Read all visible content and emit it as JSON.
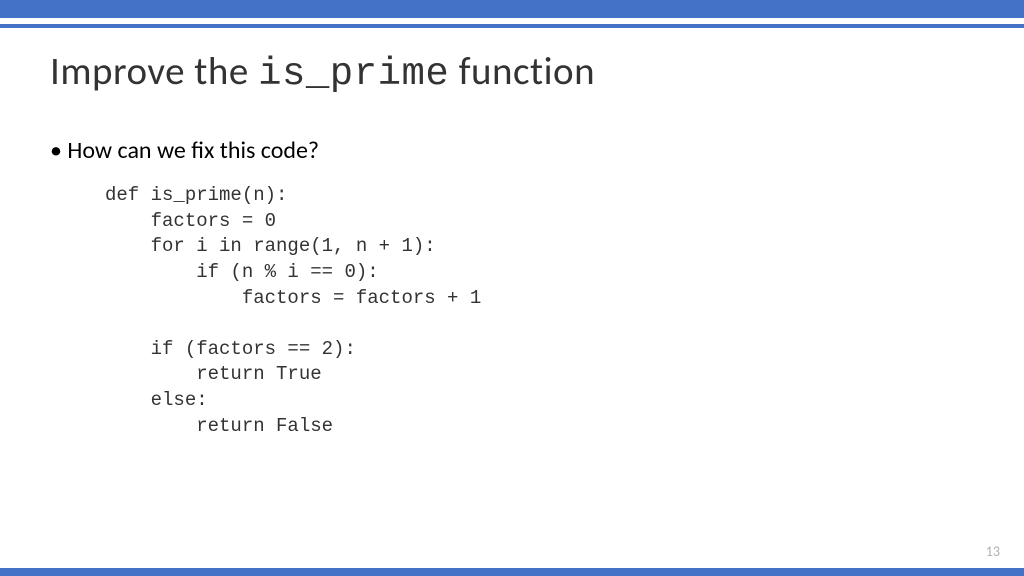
{
  "title": {
    "prefix": "Improve the ",
    "code": "is_prime",
    "suffix": " function"
  },
  "bullet": "How can we fix this code?",
  "code": "def is_prime(n):\n    factors = 0\n    for i in range(1, n + 1):\n        if (n % i == 0):\n            factors = factors + 1\n\n    if (factors == 2):\n        return True\n    else:\n        return False",
  "page_number": "13",
  "chart_data": null
}
